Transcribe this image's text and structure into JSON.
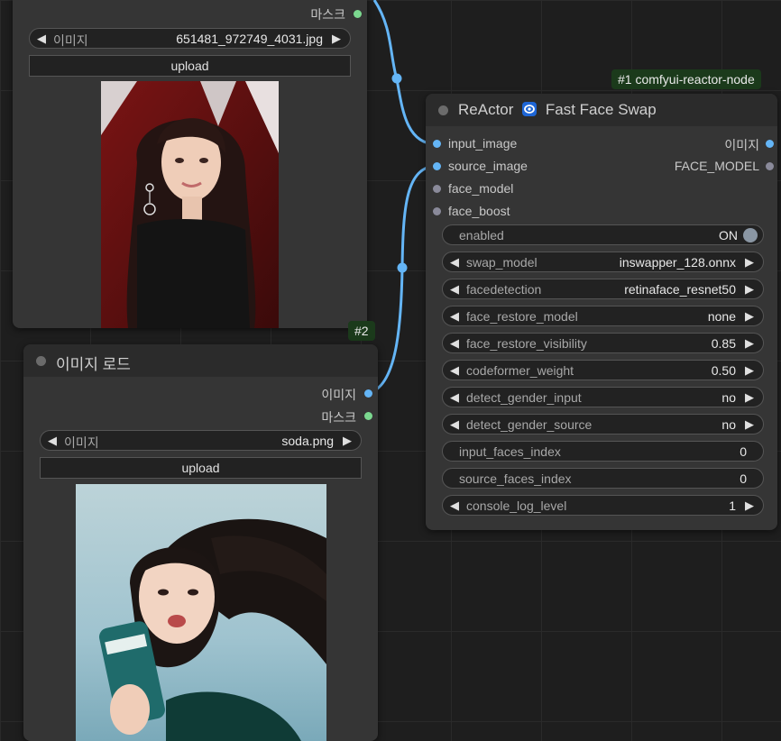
{
  "colors": {
    "canvas": "#1e1e1e",
    "node_body": "#353535",
    "node_title": "#2b2b2b",
    "wire": "#64b5f6",
    "image_socket": "#64b5f6",
    "mask_socket": "#7bd88f",
    "badge_bg": "#1b3a1b"
  },
  "top_load_node": {
    "mask_output_label": "마스크",
    "image_widget": {
      "name": "이미지",
      "value": "651481_972749_4031.jpg"
    },
    "upload_label": "upload",
    "preview": "portrait-photo-dark-hair-red-backdrop"
  },
  "load_node_2": {
    "badge": "#2",
    "title": "이미지 로드",
    "outputs": {
      "image": "이미지",
      "mask": "마스크"
    },
    "image_widget": {
      "name": "이미지",
      "value": "soda.png"
    },
    "upload_label": "upload",
    "preview": "woman-drinking-soda-can-blue-sky"
  },
  "reactor_node": {
    "badge": "#1 comfyui-reactor-node",
    "title_left": "ReActor",
    "title_icon": "reactor-logo-icon",
    "title_right": "Fast Face Swap",
    "inputs": [
      "input_image",
      "source_image",
      "face_model",
      "face_boost"
    ],
    "outputs": [
      "이미지",
      "FACE_MODEL"
    ],
    "enabled": {
      "name": "enabled",
      "value": "ON"
    },
    "widgets": [
      {
        "name": "swap_model",
        "value": "inswapper_128.onnx",
        "arrows": true
      },
      {
        "name": "facedetection",
        "value": "retinaface_resnet50",
        "arrows": true
      },
      {
        "name": "face_restore_model",
        "value": "none",
        "arrows": true
      },
      {
        "name": "face_restore_visibility",
        "value": "0.85",
        "arrows": true
      },
      {
        "name": "codeformer_weight",
        "value": "0.50",
        "arrows": true
      },
      {
        "name": "detect_gender_input",
        "value": "no",
        "arrows": true
      },
      {
        "name": "detect_gender_source",
        "value": "no",
        "arrows": true
      },
      {
        "name": "input_faces_index",
        "value": "0",
        "arrows": false
      },
      {
        "name": "source_faces_index",
        "value": "0",
        "arrows": false
      },
      {
        "name": "console_log_level",
        "value": "1",
        "arrows": true
      }
    ]
  }
}
